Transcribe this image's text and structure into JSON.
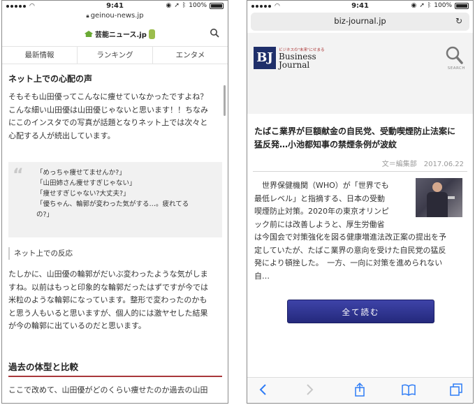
{
  "left_phone": {
    "status": {
      "time": "9:41",
      "battery": "100%"
    },
    "url": "geinou-news.jp",
    "site_logo": "芸能ニュース.jp",
    "nav_tabs": [
      "最新情報",
      "ランキング",
      "エンタメ"
    ],
    "heading": "ネット上での心配の声",
    "para1_lines": [
      "そもそも山田優ってこんなに痩せていなかったですよね？",
      "こんな細い山田優は山田優じゃないと思います！！ちなみ",
      "にこのインスタでの写真が話題となりネット上では次々と",
      "心配する人が続出しています。"
    ],
    "quote_lines": [
      "「めっちゃ痩せてませんか?」",
      "「山田姉さん痩せすぎじゃない」",
      "「痩せすぎじゃない?大丈夫?」",
      "「優ちゃん、輪郭が変わった気がする…。疲れてる",
      "の?」"
    ],
    "subheading": "ネット上での反応",
    "para2_lines": [
      "たしかに、山田優の輪郭がだいぶ変わったような気がしま",
      "すね。以前はもっと印象的な輪郭だったはずですが今では",
      "米粒のような輪郭になっています。整形で変わったのかも",
      "と思う人もいると思いますが、個人的には激ヤセした結果",
      "が今の輪郭に出ているのだと思います。"
    ],
    "section_title": "過去の体型と比較",
    "para3": "ここで改めて、山田優がどのくらい痩せたのか過去の山田"
  },
  "right_phone": {
    "status": {
      "time": "9:41",
      "battery": "100%"
    },
    "url": "biz-journal.jp",
    "logo_mark": "BJ",
    "logo_small": "ビジネスの\"未来\"にせまる",
    "logo_line1": "Business",
    "logo_line2": "Journal",
    "search_label": "SEARCH",
    "headline_lines": [
      "たばこ業界が巨額献金の自民党、受動喫煙防止法案に",
      "猛反発…小池都知事の禁煙条例が波紋"
    ],
    "byline": "文＝編集部　2017.06.22",
    "article_lines": [
      "　世界保健機関（WHO）が「世界でも",
      "最低レベル」と指摘する、日本の受動",
      "喫煙防止対策。2020年の東京オリンピ",
      "ック前には改善しようと、厚生労働省",
      "は今国会で対策強化を図る健康増進法改正案の提出を予",
      "定していたが、たばこ業界の意向を受けた自民党の猛反",
      "発により頓挫した。　一方、一向に対策を進められない",
      "自…"
    ],
    "read_button": "全て読む",
    "toolbar_icons": [
      "back-icon",
      "forward-icon",
      "share-icon",
      "bookmarks-icon",
      "tabs-icon"
    ]
  }
}
